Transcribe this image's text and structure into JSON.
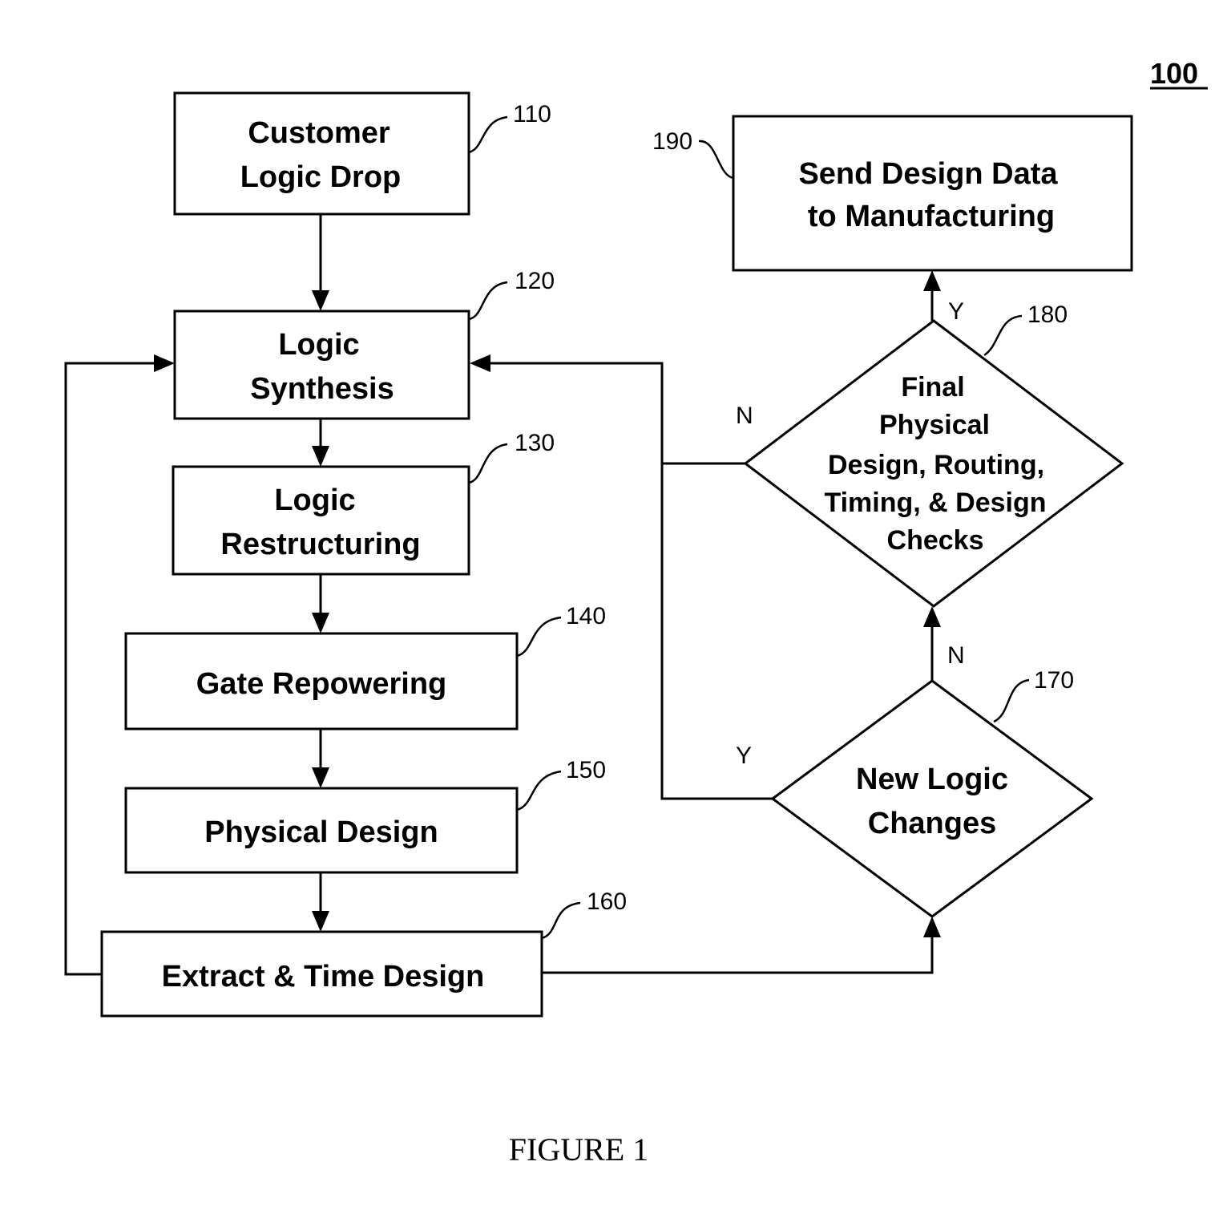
{
  "figure": {
    "number_label": "100",
    "caption": "FIGURE 1"
  },
  "nodes": {
    "n110": {
      "ref": "110",
      "lines": [
        "Customer",
        "Logic Drop"
      ]
    },
    "n120": {
      "ref": "120",
      "lines": [
        "Logic",
        "Synthesis"
      ]
    },
    "n130": {
      "ref": "130",
      "lines": [
        "Logic",
        "Restructuring"
      ]
    },
    "n140": {
      "ref": "140",
      "lines": [
        "Gate Repowering"
      ]
    },
    "n150": {
      "ref": "150",
      "lines": [
        "Physical Design"
      ]
    },
    "n160": {
      "ref": "160",
      "lines": [
        "Extract & Time Design"
      ]
    },
    "n170": {
      "ref": "170",
      "lines": [
        "New Logic",
        "Changes"
      ]
    },
    "n180": {
      "ref": "180",
      "lines": [
        "Final",
        "Physical",
        "Design, Routing,",
        "Timing, & Design",
        "Checks"
      ]
    },
    "n190": {
      "ref": "190",
      "lines": [
        "Send Design Data",
        "to Manufacturing"
      ]
    }
  },
  "edge_labels": {
    "e180_yes": "Y",
    "e180_no": "N",
    "e170_yes": "Y",
    "e170_no": "N"
  }
}
